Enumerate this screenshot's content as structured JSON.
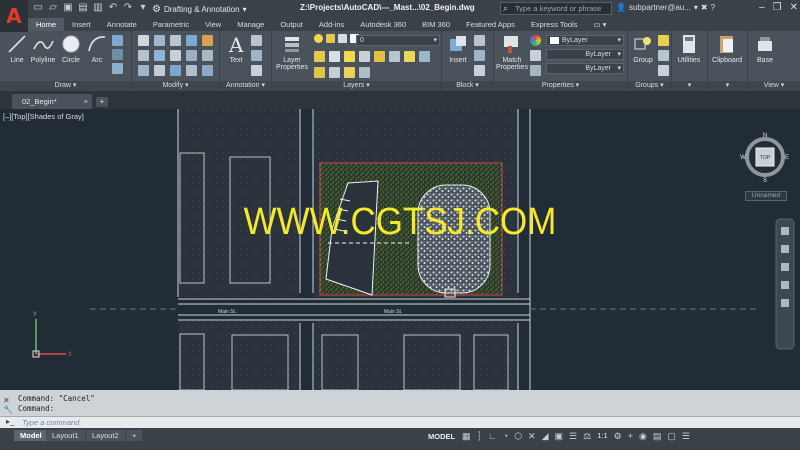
{
  "titlebar": {
    "logo_letter": "A",
    "workspace": "Drafting & Annotation",
    "document_title": "Z:\\Projects\\AutoCAD\\---_Mast...\\02_Begin.dwg",
    "search_placeholder": "Type a keyword or phrase",
    "user": "subpartner@au...",
    "help_glyph": "?",
    "minimize": "–",
    "restore": "❐",
    "close": "✕"
  },
  "ribbon_tabs": [
    {
      "label": "Home",
      "active": true
    },
    {
      "label": "Insert"
    },
    {
      "label": "Annotate"
    },
    {
      "label": "Parametric"
    },
    {
      "label": "View"
    },
    {
      "label": "Manage"
    },
    {
      "label": "Output"
    },
    {
      "label": "Add-ins"
    },
    {
      "label": "Autodesk 360"
    },
    {
      "label": "BIM 360"
    },
    {
      "label": "Featured Apps"
    },
    {
      "label": "Express Tools"
    },
    {
      "label": "▭ ▾"
    }
  ],
  "ribbon": {
    "draw": {
      "title": "Draw ▾",
      "line": "Line",
      "polyline": "Polyline",
      "circle": "Circle",
      "arc": "Arc"
    },
    "modify": {
      "title": "Modify ▾"
    },
    "annotation": {
      "title": "Annotation ▾",
      "text": "Text"
    },
    "layers": {
      "title": "Layers ▾",
      "layer_properties_1": "Layer",
      "layer_properties_2": "Properties",
      "layer_value": "0"
    },
    "block": {
      "title": "Block ▾",
      "insert": "Insert"
    },
    "properties": {
      "title": "Properties ▾",
      "match_1": "Match",
      "match_2": "Properties",
      "color": "ByLayer",
      "linetype": "ByLayer",
      "lineweight": "ByLayer"
    },
    "groups": {
      "title": "Groups ▾",
      "group": "Group"
    },
    "utilities": {
      "label": "Utilities",
      "title": "▾"
    },
    "clipboard": {
      "label": "Clipboard",
      "title": "▾"
    },
    "view": {
      "base": "Base",
      "title": "View ▾"
    }
  },
  "doc_tabs": {
    "active": "02_Begin*",
    "close": "×",
    "add": "+"
  },
  "canvas": {
    "view_label": "[–][Top][Shades of Gray]",
    "watermark": "WWW.CGTSJ.COM",
    "viewcube": {
      "face": "TOP",
      "n": "N",
      "s": "S",
      "e": "E",
      "w": "W"
    },
    "ucs_dropdown": "Unnamed",
    "street_label": "Main St."
  },
  "command": {
    "history": [
      "Command: \"Cancel\"",
      "Command:"
    ],
    "placeholder": "Type a command"
  },
  "status": {
    "layouts": [
      {
        "label": "Model",
        "active": true
      },
      {
        "label": "Layout1"
      },
      {
        "label": "Layout2"
      },
      {
        "label": "+"
      }
    ],
    "model": "MODEL",
    "scale": "1:1"
  }
}
